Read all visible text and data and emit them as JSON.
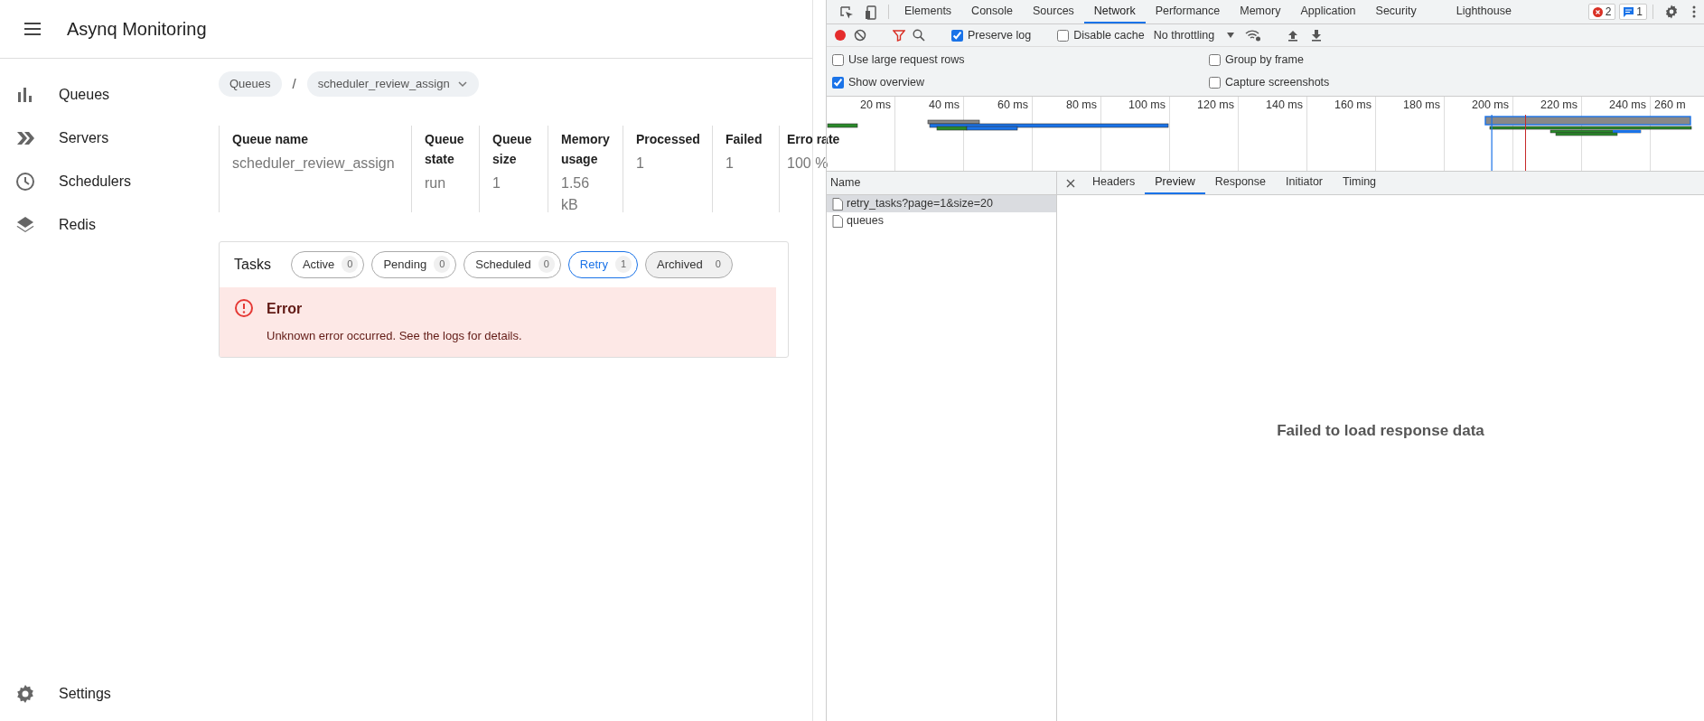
{
  "app": {
    "title": "Asynq Monitoring",
    "nav": [
      {
        "label": "Queues"
      },
      {
        "label": "Servers"
      },
      {
        "label": "Schedulers"
      },
      {
        "label": "Redis"
      }
    ],
    "settings": {
      "label": "Settings"
    },
    "breadcrumb": {
      "root": "Queues",
      "separator": "/",
      "current": "scheduler_review_assign"
    },
    "stats": [
      {
        "heading": "Queue name",
        "value": "scheduler_review_assign"
      },
      {
        "heading": "Queue state",
        "value": "run"
      },
      {
        "heading": "Queue size",
        "value": "1"
      },
      {
        "heading": "Memory usage",
        "value": "1.56 kB"
      },
      {
        "heading": "Processed",
        "value": "1"
      },
      {
        "heading": "Failed",
        "value": "1"
      },
      {
        "heading": "Erro rate",
        "value": "100 %"
      }
    ],
    "tasks": {
      "title": "Tasks",
      "tabs": [
        {
          "label": "Active",
          "count": "0",
          "selected": false
        },
        {
          "label": "Pending",
          "count": "0",
          "selected": false
        },
        {
          "label": "Scheduled",
          "count": "0",
          "selected": false
        },
        {
          "label": "Retry",
          "count": "1",
          "selected": true
        },
        {
          "label": "Archived",
          "count": "0",
          "selected": false
        }
      ]
    },
    "error": {
      "title": "Error",
      "message": "Unknown error occurred. See the logs for details."
    }
  },
  "devtools": {
    "tabs": [
      {
        "label": "Elements",
        "selected": false
      },
      {
        "label": "Console",
        "selected": false
      },
      {
        "label": "Sources",
        "selected": false
      },
      {
        "label": "Network",
        "selected": true
      },
      {
        "label": "Performance",
        "selected": false
      },
      {
        "label": "Memory",
        "selected": false
      },
      {
        "label": "Application",
        "selected": false
      },
      {
        "label": "Security",
        "selected": false
      },
      {
        "label": "Lighthouse",
        "selected": false
      }
    ],
    "error_count": "2",
    "message_count": "1",
    "toolbar": {
      "recording": true,
      "preserve_log": {
        "label": "Preserve log",
        "checked": true
      },
      "disable_cache": {
        "label": "Disable cache",
        "checked": false
      },
      "throttling": "No throttling"
    },
    "options": [
      {
        "label": "Use large request rows",
        "checked": false
      },
      {
        "label": "Group by frame",
        "checked": false
      },
      {
        "label": "Show overview",
        "checked": true
      },
      {
        "label": "Capture screenshots",
        "checked": false
      }
    ],
    "overview": {
      "ticks": [
        "20 ms",
        "40 ms",
        "60 ms",
        "80 ms",
        "100 ms",
        "120 ms",
        "140 ms",
        "160 ms",
        "180 ms",
        "200 ms",
        "220 ms",
        "240 ms",
        "260 m"
      ]
    },
    "requests": {
      "column": "Name",
      "rows": [
        {
          "name": "retry_tasks?page=1&size=20",
          "selected": true
        },
        {
          "name": "queues",
          "selected": false
        }
      ]
    },
    "detail": {
      "tabs": [
        {
          "label": "Headers",
          "selected": false
        },
        {
          "label": "Preview",
          "selected": true
        },
        {
          "label": "Response",
          "selected": false
        },
        {
          "label": "Initiator",
          "selected": false
        },
        {
          "label": "Timing",
          "selected": false
        }
      ],
      "message": "Failed to load response data"
    }
  }
}
